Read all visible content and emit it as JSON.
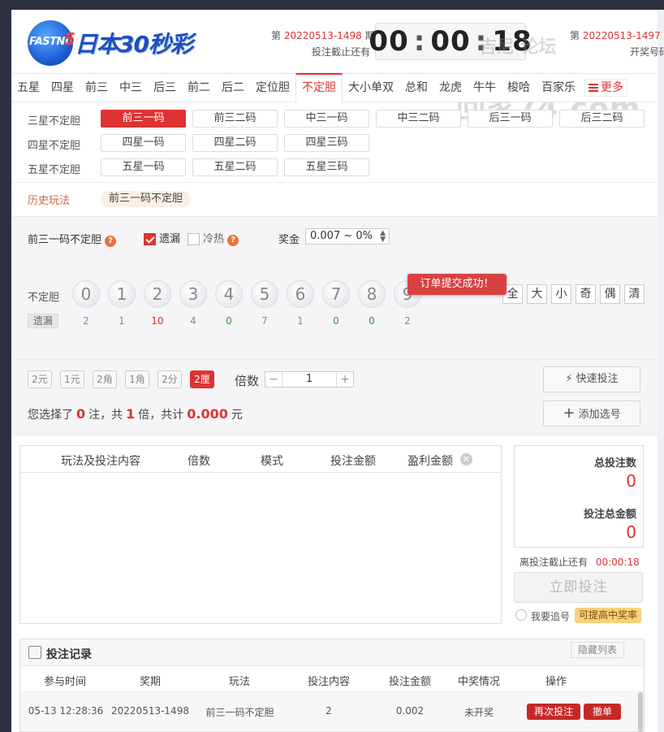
{
  "header": {
    "logo_latin": "FASTNUM",
    "logo_number": "5",
    "logo_cn": "日本30秒彩",
    "current_prefix": "第",
    "current_issue": "20220513-1498",
    "current_suffix": "期",
    "deadline_label": "投注截止还有",
    "timer": {
      "h": "00",
      "m": "00",
      "s": "18"
    },
    "prev_prefix": "第",
    "prev_issue": "20220513-1497",
    "prev_suffix": "期",
    "draw_label": "开奖号码",
    "watermark_top": "吉尼  论坛",
    "watermark_bottom": "回家74.com"
  },
  "tabs": [
    {
      "label": "五星"
    },
    {
      "label": "四星"
    },
    {
      "label": "前三"
    },
    {
      "label": "中三"
    },
    {
      "label": "后三"
    },
    {
      "label": "前二"
    },
    {
      "label": "后二"
    },
    {
      "label": "定位胆"
    },
    {
      "label": "不定胆"
    },
    {
      "label": "大小单双"
    },
    {
      "label": "总和"
    },
    {
      "label": "龙虎"
    },
    {
      "label": "牛牛"
    },
    {
      "label": "梭哈"
    },
    {
      "label": "百家乐"
    }
  ],
  "more_label": "更多",
  "play_rows": [
    {
      "label": "三星不定胆",
      "options": [
        "前三一码",
        "前三二码",
        "中三一码",
        "中三二码",
        "后三一码",
        "后三二码"
      ]
    },
    {
      "label": "四星不定胆",
      "options": [
        "四星一码",
        "四星二码",
        "四星三码"
      ]
    },
    {
      "label": "五星不定胆",
      "options": [
        "五星一码",
        "五星二码",
        "五星三码"
      ]
    }
  ],
  "history": {
    "label": "历史玩法",
    "chip": "前三一码不定胆"
  },
  "selector": {
    "play_name": "前三一码不定胆",
    "miss_label": "遗漏",
    "hotcold_label": "冷热",
    "prize_label": "奖金",
    "prize_value": "0.007 ~ 0%",
    "row_label": "不定胆",
    "miss_row_label": "遗漏",
    "balls": [
      "0",
      "1",
      "2",
      "3",
      "4",
      "5",
      "6",
      "7",
      "8",
      "9"
    ],
    "misses": [
      "2",
      "1",
      "10",
      "4",
      "0",
      "7",
      "1",
      "0",
      "0",
      "2"
    ],
    "quick": [
      "全",
      "大",
      "小",
      "奇",
      "偶",
      "清"
    ],
    "toast": "订单提交成功！"
  },
  "units": [
    "2元",
    "1元",
    "2角",
    "1角",
    "2分",
    "2厘"
  ],
  "multiplier": {
    "label": "倍数",
    "minus": "−",
    "value": "1",
    "plus": "+"
  },
  "actions": {
    "quick_bet": "快速投注",
    "add": "添加选号"
  },
  "summary": {
    "p1": "您选择了",
    "count": "0",
    "p2": "注，共",
    "times": "1",
    "p3": "倍，共计",
    "amount": "0.000",
    "p4": "元"
  },
  "cart": {
    "headers": [
      "玩法及投注内容",
      "倍数",
      "模式",
      "投注金额",
      "盈利金额"
    ]
  },
  "totals": {
    "count_label": "总投注数",
    "count": "0",
    "amount_label": "投注总金额",
    "amount": "0"
  },
  "deadline": {
    "label": "离投注截止还有",
    "value": "00:00:18"
  },
  "bet_button": "立即投注",
  "chase": {
    "label": "我要追号",
    "badge": "可提高中奖率"
  },
  "records": {
    "title": "投注记录",
    "hide_label": "隐藏列表",
    "headers": [
      "参与时间",
      "奖期",
      "玩法",
      "投注内容",
      "投注金额",
      "中奖情况",
      "操作"
    ],
    "rows": [
      {
        "time": "05-13 12:28:36",
        "issue": "20220513-1498",
        "play": "前三一码不定胆",
        "content": "2",
        "amount": "0.002",
        "status": "未开奖",
        "rebet": "再次投注",
        "cancel": "撤单"
      }
    ]
  }
}
